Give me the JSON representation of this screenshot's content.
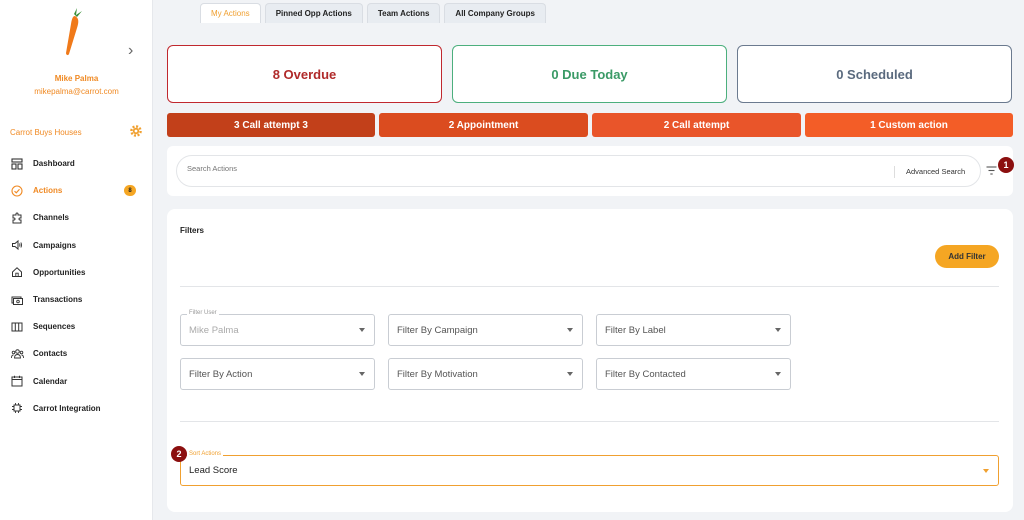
{
  "user": {
    "name": "Mike Palma",
    "email": "mikepalma@carrot.com"
  },
  "company": "Carrot Buys Houses",
  "icons": {
    "logo": "carrot-logo",
    "collapse": "chevron-right-icon",
    "settings": "gear-icon",
    "filter": "filter-list-icon"
  },
  "nav": {
    "dashboard": "Dashboard",
    "actions": "Actions",
    "actions_badge": "8",
    "channels": "Channels",
    "campaigns": "Campaigns",
    "opportunities": "Opportunities",
    "transactions": "Transactions",
    "sequences": "Sequences",
    "contacts": "Contacts",
    "calendar": "Calendar",
    "integration": "Carrot Integration"
  },
  "tabs": {
    "my_actions": "My Actions",
    "pinned": "Pinned Opp Actions",
    "team": "Team Actions",
    "groups": "All Company Groups"
  },
  "summary": {
    "overdue": "8 Overdue",
    "due_today": "0 Due Today",
    "scheduled": "0 Scheduled"
  },
  "action_types": {
    "call3": "3  Call attempt 3",
    "appointment": "2  Appointment",
    "call2": "2  Call attempt",
    "custom": "1  Custom action"
  },
  "colors": {
    "accent": "#f08a24",
    "call3": "#c2401a",
    "appointment": "#db4c1f",
    "call2": "#e9552a",
    "custom": "#f35d27"
  },
  "search": {
    "placeholder": "Search Actions",
    "advanced": "Advanced Search"
  },
  "markers": {
    "one": "1",
    "two": "2"
  },
  "filters": {
    "title": "Filters",
    "add_button": "Add Filter",
    "user_legend": "Filter User",
    "user_value": "Mike Palma",
    "campaign": "Filter By Campaign",
    "label": "Filter By Label",
    "action": "Filter By Action",
    "motivation": "Filter By Motivation",
    "contacted": "Filter By Contacted"
  },
  "sort": {
    "legend": "Sort Actions",
    "value": "Lead Score"
  }
}
